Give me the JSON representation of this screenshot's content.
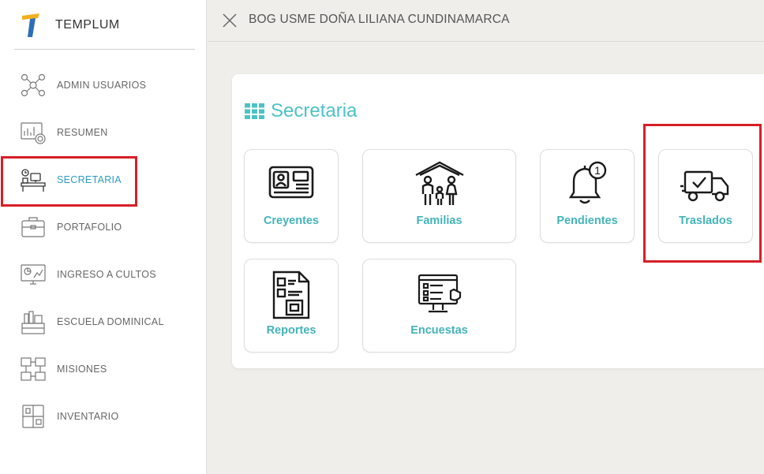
{
  "app": {
    "name": "TEMPLUM"
  },
  "sidebar": {
    "items": [
      {
        "label": "ADMIN USUARIOS",
        "icon": "users-network-icon"
      },
      {
        "label": "RESUMEN",
        "icon": "dashboard-chart-icon"
      },
      {
        "label": "SECRETARIA",
        "icon": "office-desk-icon",
        "active": true
      },
      {
        "label": "PORTAFOLIO",
        "icon": "briefcase-icon"
      },
      {
        "label": "INGRESO A CULTOS",
        "icon": "monitor-analytics-icon"
      },
      {
        "label": "ESCUELA DOMINICAL",
        "icon": "school-supplies-icon"
      },
      {
        "label": "MISIONES",
        "icon": "mission-map-icon"
      },
      {
        "label": "INVENTARIO",
        "icon": "inventory-boxes-icon"
      }
    ]
  },
  "header": {
    "title": "BOG USME DOÑA LILIANA CUNDINAMARCA"
  },
  "main": {
    "section_title": "Secretaria",
    "tiles": [
      {
        "label": "Creyentes",
        "icon": "id-card-icon"
      },
      {
        "label": "Familias",
        "icon": "family-home-icon"
      },
      {
        "label": "Pendientes",
        "icon": "notification-bell-icon",
        "badge": "1"
      },
      {
        "label": "Traslados",
        "icon": "delivery-truck-icon"
      },
      {
        "label": "Reportes",
        "icon": "report-document-icon"
      },
      {
        "label": "Encuestas",
        "icon": "survey-screen-icon"
      }
    ]
  },
  "colors": {
    "accent": "#4dc2c6",
    "active_link": "#2e9bc6",
    "highlight": "#d61f26"
  }
}
